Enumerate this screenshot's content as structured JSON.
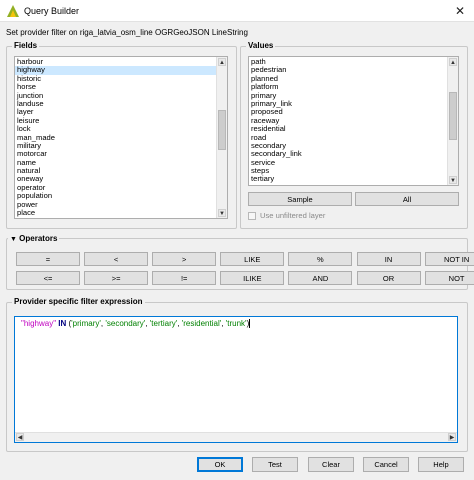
{
  "window": {
    "title": "Query Builder",
    "close_glyph": "✕"
  },
  "subtitle": "Set provider filter on riga_latvia_osm_line OGRGeoJSON LineString",
  "fields": {
    "title": "Fields",
    "items": [
      "harbour",
      "highway",
      "historic",
      "horse",
      "junction",
      "landuse",
      "layer",
      "leisure",
      "lock",
      "man_made",
      "military",
      "motorcar",
      "name",
      "natural",
      "oneway",
      "operator",
      "population",
      "power",
      "place"
    ],
    "selected_index": 1
  },
  "values": {
    "title": "Values",
    "items": [
      "path",
      "pedestrian",
      "planned",
      "platform",
      "primary",
      "primary_link",
      "proposed",
      "raceway",
      "residential",
      "road",
      "secondary",
      "secondary_link",
      "service",
      "steps",
      "tertiary"
    ],
    "sample_label": "Sample",
    "all_label": "All",
    "unfiltered_label": "Use unfiltered layer"
  },
  "operators": {
    "title": "Operators",
    "row1": [
      "=",
      "<",
      ">",
      "LIKE",
      "%",
      "IN",
      "NOT IN"
    ],
    "row2": [
      "<=",
      ">=",
      "!=",
      "ILIKE",
      "AND",
      "OR",
      "NOT"
    ]
  },
  "expression": {
    "title": "Provider specific filter expression",
    "tokens": [
      {
        "t": "\"highway\"",
        "k": "field"
      },
      {
        "t": " ",
        "k": "punc"
      },
      {
        "t": "IN",
        "k": "kw"
      },
      {
        "t": " (",
        "k": "punc"
      },
      {
        "t": "'primary'",
        "k": "str"
      },
      {
        "t": ", ",
        "k": "punc"
      },
      {
        "t": "'secondary'",
        "k": "str"
      },
      {
        "t": ", ",
        "k": "punc"
      },
      {
        "t": "'tertiary'",
        "k": "str"
      },
      {
        "t": ", ",
        "k": "punc"
      },
      {
        "t": "'residential'",
        "k": "str"
      },
      {
        "t": ", ",
        "k": "punc"
      },
      {
        "t": "'trunk'",
        "k": "str"
      },
      {
        "t": ")",
        "k": "punc"
      }
    ]
  },
  "buttons": {
    "ok": "OK",
    "test": "Test",
    "clear": "Clear",
    "cancel": "Cancel",
    "help": "Help"
  },
  "colors": {
    "accent": "#0078d7",
    "selection": "#cce8ff"
  }
}
